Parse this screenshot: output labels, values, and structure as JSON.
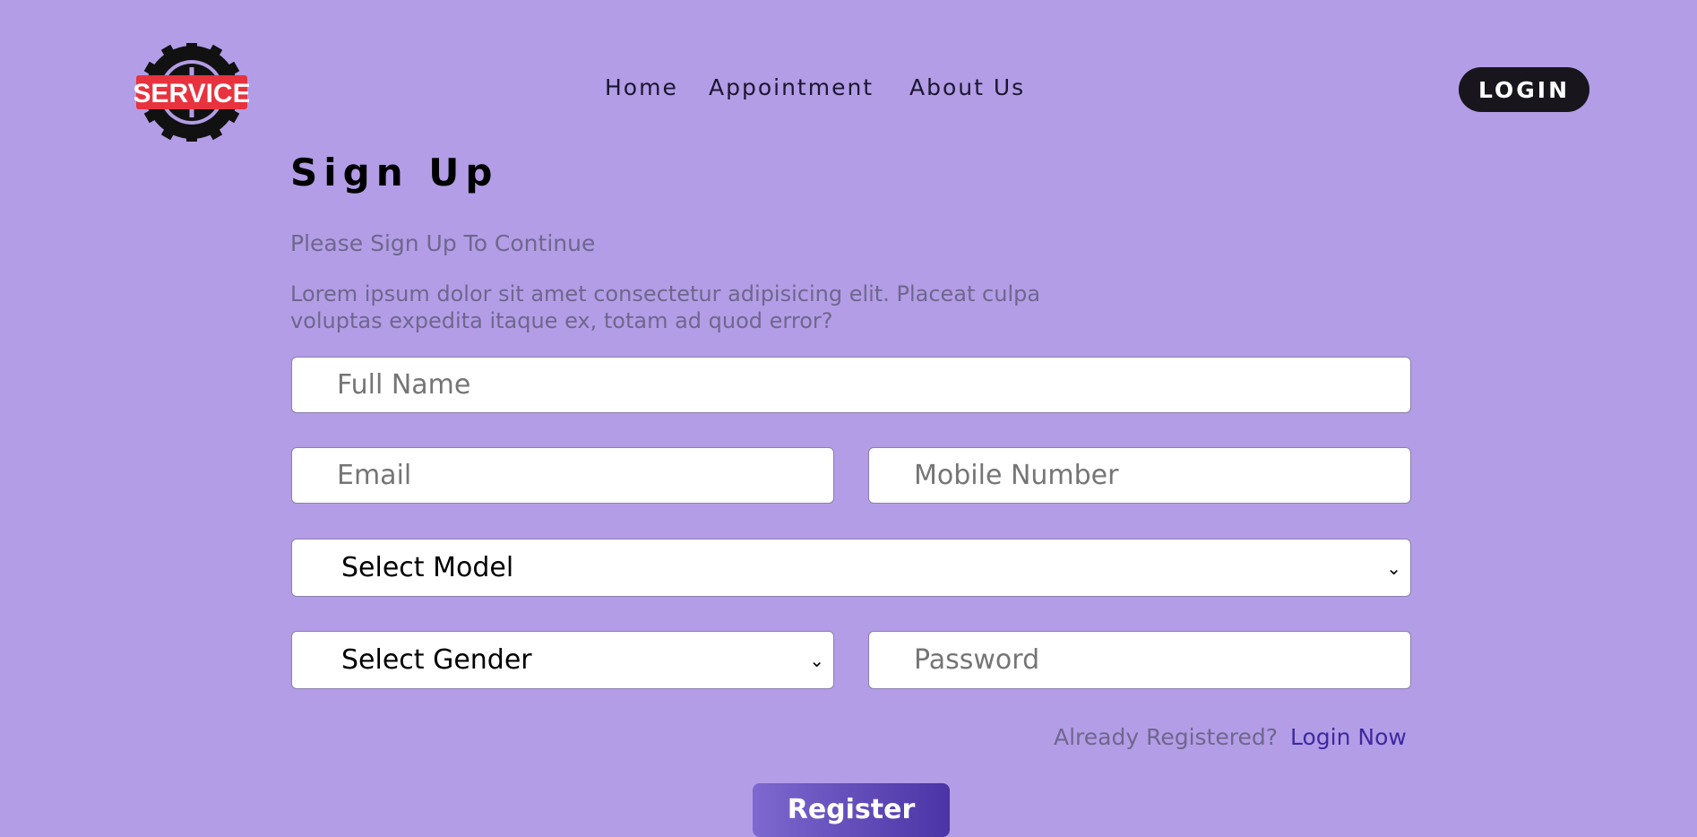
{
  "logo": {
    "text": "SERVICE",
    "icon": "tire-gear-icon",
    "colors": {
      "ring": "#111111",
      "banner": "#e8333f",
      "text": "#ffffff"
    }
  },
  "nav": {
    "items": [
      {
        "label": "Home"
      },
      {
        "label": "Appointment"
      },
      {
        "label": "About Us"
      }
    ]
  },
  "header": {
    "login_label": "LOGIN"
  },
  "form": {
    "title": "Sign Up",
    "subtitle": "Please Sign Up To Continue",
    "description": "Lorem ipsum dolor sit amet consectetur adipisicing elit. Placeat culpa voluptas expedita itaque ex, totam ad quod error?",
    "full_name_placeholder": "Full Name",
    "email_placeholder": "Email",
    "mobile_placeholder": "Mobile Number",
    "model_selected": "Select Model",
    "gender_selected": "Select Gender",
    "password_placeholder": "Password",
    "already_registered": "Already Registered?",
    "login_now": "Login Now",
    "register_label": "Register"
  },
  "colors": {
    "background": "#b39de6",
    "accent": "#3e2aa0",
    "button_dark": "#18161c"
  }
}
